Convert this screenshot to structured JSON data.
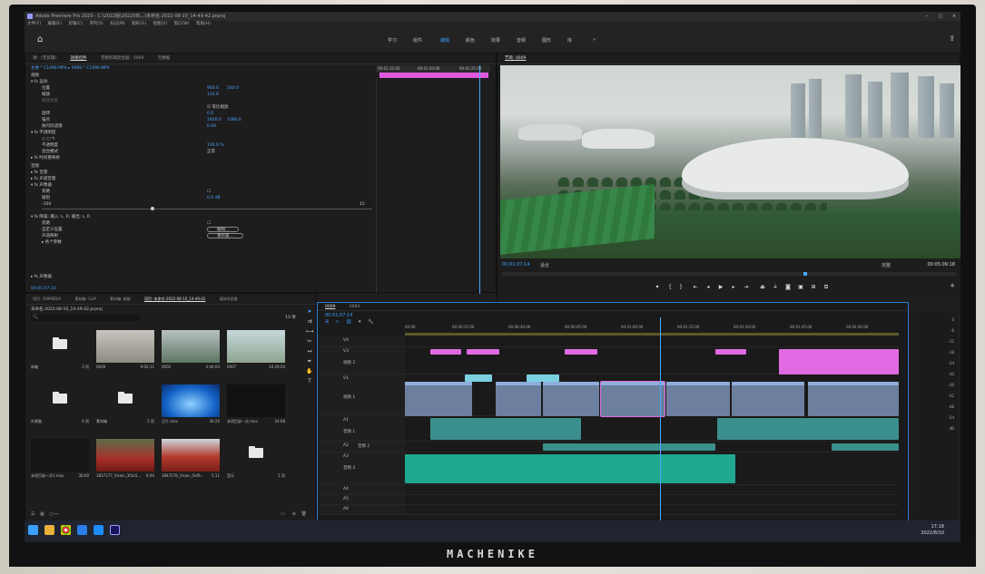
{
  "app": {
    "title": "Adobe Premiere Pro 2020 - C:\\2022版\\202208\\...\\未命名-2022-08-10_14-49-42.prproj",
    "menu": [
      "文件(F)",
      "编辑(E)",
      "剪辑(C)",
      "序列(S)",
      "标记(M)",
      "图形(G)",
      "视图(V)",
      "窗口(W)",
      "帮助(H)"
    ]
  },
  "workspaces": {
    "items": [
      "学习",
      "组件",
      "编辑",
      "颜色",
      "效果",
      "音频",
      "图形",
      "库"
    ],
    "active": "编辑"
  },
  "effect_controls": {
    "tabs": [
      "源：(无剪辑)",
      "效果控件",
      "音频剪辑混合器：0009",
      "元数据"
    ],
    "active_tab": "效果控件",
    "clip_path": "主要 * C1496.MP4 ▸ 0009 * C1496.MP4",
    "time_start": "00:01:15:00",
    "time_mid": "00:01:20:00",
    "time_end": "00:01:25:00",
    "section_video": "视频",
    "motion": "运动",
    "position_label": "位置",
    "position_x": "960.0",
    "position_y": "540.0",
    "scale_label": "缩放",
    "scale_value": "133.0",
    "scale_width_label": "缩放宽度",
    "uniform_scale": "等比缩放",
    "rotation_label": "旋转",
    "rotation_value": "0.0",
    "anchor_label": "锚点",
    "anchor_x": "1920.0",
    "anchor_y": "1080.0",
    "antiflicker_label": "防闪烁滤镜",
    "antiflicker_value": "0.00",
    "opacity_section": "不透明度",
    "opacity_label": "不透明度",
    "opacity_value": "100.0 %",
    "blend_label": "混合模式",
    "blend_value": "正常",
    "remap": "时间重映射",
    "section_audio": "音频",
    "volume": "音量",
    "channel_volume": "声道音量",
    "panner": "声像器",
    "bypass": "旁路",
    "level_label": "级别",
    "level_value": "0.0 dB",
    "slider_min": "-100",
    "slider_max": "15",
    "adjust": "降噪: 输入: L, R; 输出: L, R",
    "param1": "旁路",
    "param2": "自定义设置",
    "param3": "声道映射",
    "param4": "各个参数",
    "edit_button": "编辑...",
    "reset_button": "重新置...",
    "mixer": "声像器",
    "footer_time": "00:01:07:14"
  },
  "program_monitor": {
    "title": "节目: 0009",
    "timecode": "00:01:07:14",
    "fit": "适合",
    "quality": "完整",
    "duration": "00:05:09:18"
  },
  "project": {
    "tabs": [
      "项目: 100MEDIA",
      "素材箱: CLIP",
      "素材箱: 新箱",
      "项目: 未命名-2022-08-10_14-49-42",
      "媒体浏览器"
    ],
    "active_tab": "项目: 未命名-2022-08-10_14-49-42",
    "file_name": "未命名-2022-08-10_14-49-42.prproj",
    "count": "13 项",
    "items": [
      {
        "name": "新箱",
        "meta": "3 项",
        "type": "folder"
      },
      {
        "name": "0009",
        "meta": "9:02:11",
        "type": "clip"
      },
      {
        "name": "0002",
        "meta": "4:44:04",
        "type": "clip"
      },
      {
        "name": "0007",
        "meta": "10:29:20",
        "type": "clip"
      },
      {
        "name": "外景备",
        "meta": "4 项",
        "type": "folder"
      },
      {
        "name": "素材箱",
        "meta": "5 项",
        "type": "folder"
      },
      {
        "name": "正片.mov",
        "meta": "30:20",
        "type": "clip"
      },
      {
        "name": "未项目录一次.mov",
        "meta": "24:08",
        "type": "clip"
      },
      {
        "name": "未项目录一次1.mov",
        "meta": "30:00",
        "type": "clip"
      },
      {
        "name": "3857377_Vision_3f2e5...",
        "meta": "6:00",
        "type": "clip"
      },
      {
        "name": "3847278_Vision_5ef9...",
        "meta": "5:11",
        "type": "clip"
      },
      {
        "name": "音乐",
        "meta": "1 项",
        "type": "folder"
      }
    ]
  },
  "timeline": {
    "tab": "0009",
    "tab2": "0004",
    "timecode": "00:01:07:14",
    "ruler": [
      "00:00",
      "00:00:15:00",
      "00:00:30:00",
      "00:00:45:00",
      "00:01:00:00",
      "00:01:15:00",
      "00:01:30:00",
      "00:01:45:00",
      "00:02:00:00"
    ],
    "tracks": [
      "V4",
      "V3",
      "视频 2",
      "V1",
      "视频 1",
      "A1",
      "音频 1",
      "A2",
      "音频 2",
      "A3",
      "音频 3",
      "A4",
      "A5",
      "A6"
    ],
    "meter_labels": [
      "0",
      "-6",
      "-12",
      "-18",
      "-24",
      "-30",
      "-36",
      "-42",
      "-48",
      "-54",
      "dB"
    ]
  },
  "taskbar": {
    "time": "17:18",
    "date": "2022/8/10"
  },
  "monitor": {
    "brand": "MACHENIKE"
  }
}
